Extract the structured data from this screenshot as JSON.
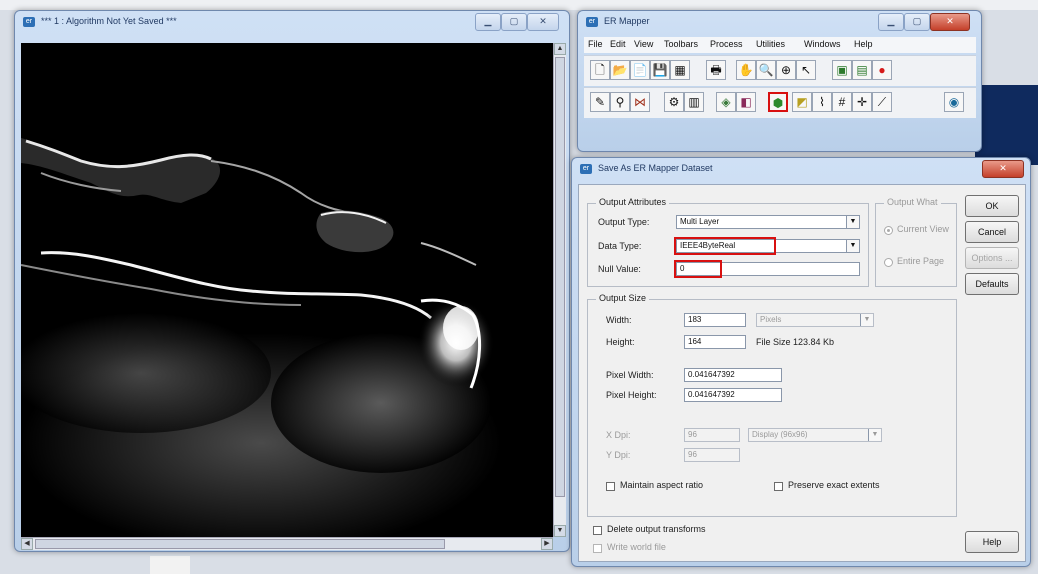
{
  "algorithm_window": {
    "title": "*** 1 : Algorithm Not Yet Saved ***"
  },
  "ermapper_window": {
    "title": "ER Mapper",
    "menu": [
      "File",
      "Edit",
      "View",
      "Toolbars",
      "Process",
      "Utilities",
      "Windows",
      "Help"
    ],
    "toolbar1_icons": [
      "new-icon",
      "open-icon",
      "open-copy-icon",
      "save-icon",
      "save-as-icon",
      "print-icon",
      "pointer-hand-icon",
      "zoom-icon",
      "zoom-box-icon",
      "select-arrow-icon",
      "page-setup-icon",
      "page-setup2-icon",
      "stop-icon"
    ],
    "toolbar2_icons": [
      "annotation-icon",
      "geolink-icon",
      "mosaic-icon",
      "edit-algorithm-icon",
      "dataset-icon",
      "layer-icon",
      "layer2-icon",
      "save-dataset-icon",
      "classify-icon",
      "histogram-icon",
      "filter-icon",
      "crosshair-icon",
      "transform-icon",
      "world-icon"
    ],
    "highlight_color": "#d81010"
  },
  "save_dialog": {
    "title": "Save As ER Mapper Dataset",
    "output_attributes": {
      "group_label": "Output Attributes",
      "output_type_label": "Output Type:",
      "output_type_value": "Multi Layer",
      "data_type_label": "Data Type:",
      "data_type_value": "IEEE4ByteReal",
      "null_value_label": "Null Value:",
      "null_value_value": "0"
    },
    "output_what": {
      "group_label": "Output What",
      "current_view": "Current View",
      "entire_page": "Entire Page"
    },
    "output_size": {
      "group_label": "Output Size",
      "width_label": "Width:",
      "width_value": "183",
      "width_unit": "Pixels",
      "height_label": "Height:",
      "height_value": "164",
      "file_size": "File Size 123.84 Kb",
      "pixel_width_label": "Pixel Width:",
      "pixel_width_value": "0.041647392",
      "pixel_height_label": "Pixel Height:",
      "pixel_height_value": "0.041647392",
      "x_dpi_label": "X Dpi:",
      "x_dpi_value": "96",
      "dpi_option": "Display (96x96)",
      "y_dpi_label": "Y Dpi:",
      "y_dpi_value": "96",
      "maintain_aspect": "Maintain aspect ratio",
      "preserve_extents": "Preserve exact extents"
    },
    "delete_transforms": "Delete output transforms",
    "write_world_file": "Write world file",
    "buttons": {
      "ok": "OK",
      "cancel": "Cancel",
      "options": "Options ...",
      "defaults": "Defaults",
      "help": "Help"
    }
  }
}
